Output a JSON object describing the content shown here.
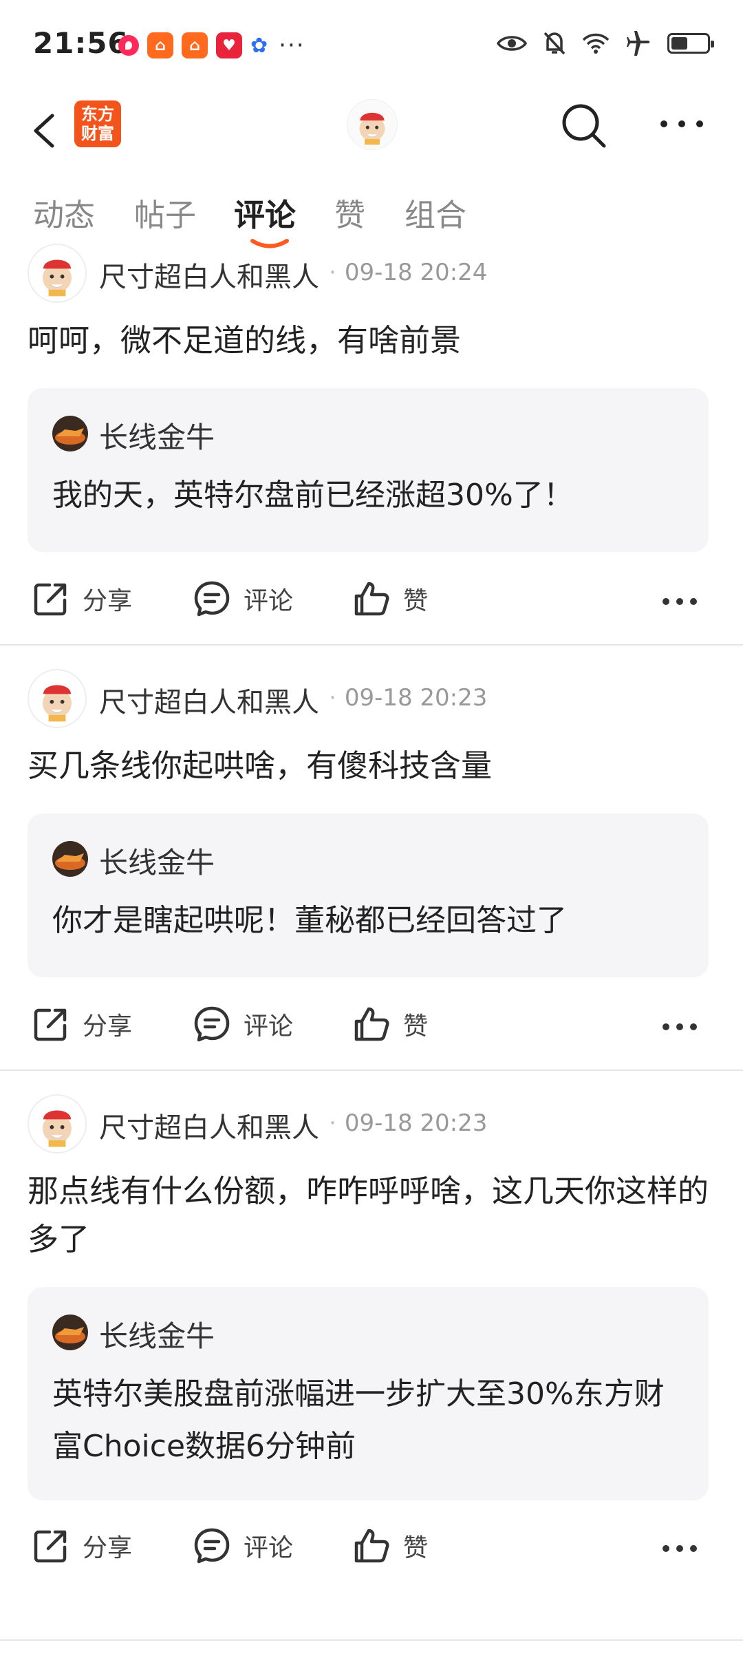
{
  "status_bar": {
    "time": "21:56",
    "apps": [
      "notification-app-icon",
      "bilibili-icon",
      "bilibili-icon",
      "tmall-1111-icon",
      "baidu-icon"
    ],
    "more": "···",
    "battery_level": 0.45
  },
  "nav": {
    "logo_line1": "东方",
    "logo_line2": "财富"
  },
  "tabs": [
    {
      "label": "动态",
      "active": false
    },
    {
      "label": "帖子",
      "active": false
    },
    {
      "label": "评论",
      "active": true
    },
    {
      "label": "赞",
      "active": false
    },
    {
      "label": "组合",
      "active": false
    }
  ],
  "posts": [
    {
      "author": "尺寸超白人和黑人",
      "time": "09-18 20:24",
      "body": "呵呵，微不足道的线，有啥前景",
      "quote": {
        "author": "长线金牛",
        "text": "我的天，英特尔盘前已经涨超30%了！"
      }
    },
    {
      "author": "尺寸超白人和黑人",
      "time": "09-18 20:23",
      "body": "买几条线你起哄啥，有傻科技含量",
      "quote": {
        "author": "长线金牛",
        "text": "你才是瞎起哄呢！董秘都已经回答过了"
      }
    },
    {
      "author": "尺寸超白人和黑人",
      "time": "09-18 20:23",
      "body": "那点线有什么份额，咋咋呼呼啥，这几天你这样的多了",
      "quote": {
        "author": "长线金牛",
        "text": "英特尔美股盘前涨幅进一步扩大至30%东方财富Choice数据6分钟前"
      }
    }
  ],
  "actions": {
    "share": "分享",
    "comment": "评论",
    "like": "赞"
  },
  "colors": {
    "accent": "#ff5a1f",
    "logo_bg": "#f2541b",
    "quote_bg": "#f5f5f7"
  }
}
